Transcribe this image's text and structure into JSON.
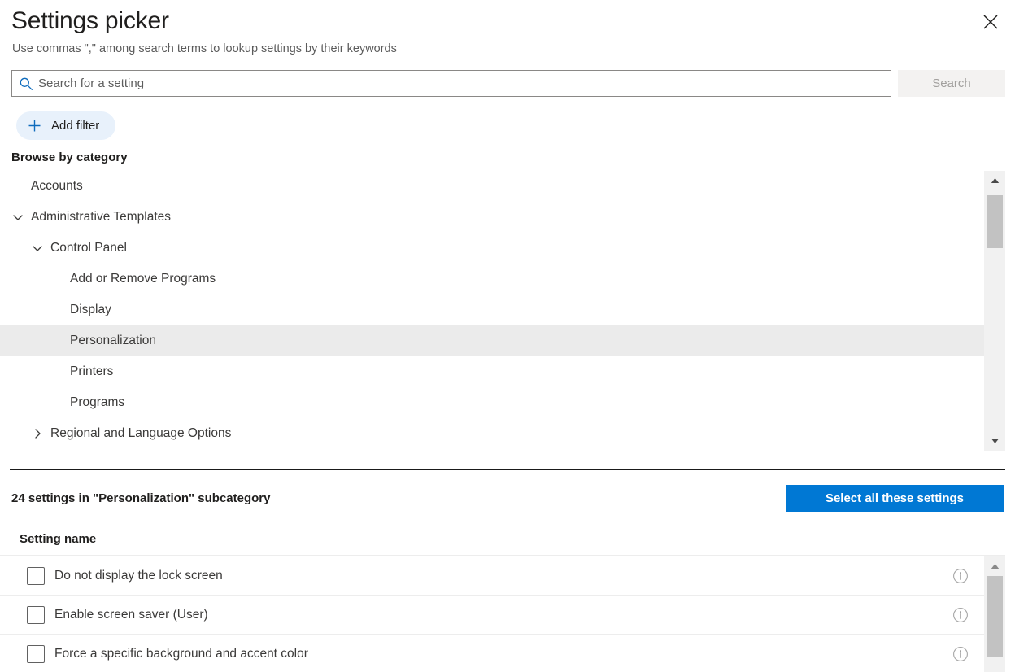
{
  "header": {
    "title": "Settings picker",
    "subtitle": "Use commas \",\" among search terms to lookup settings by their keywords",
    "close_icon": "close-icon"
  },
  "search": {
    "placeholder": "Search for a setting",
    "value": "",
    "icon": "search-icon",
    "button_label": "Search",
    "button_enabled": false
  },
  "filters": {
    "add_filter_label": "Add filter",
    "add_filter_icon": "plus-icon",
    "accent_color": "#0078d4",
    "pill_background": "#e8f1fb"
  },
  "browse": {
    "heading": "Browse by category",
    "tree": [
      {
        "label": "Accounts",
        "depth": 0,
        "state": "leaf",
        "selected": false
      },
      {
        "label": "Administrative Templates",
        "depth": 0,
        "state": "expanded",
        "selected": false
      },
      {
        "label": "Control Panel",
        "depth": 1,
        "state": "expanded",
        "selected": false
      },
      {
        "label": "Add or Remove Programs",
        "depth": 2,
        "state": "leaf",
        "selected": false
      },
      {
        "label": "Display",
        "depth": 2,
        "state": "leaf",
        "selected": false
      },
      {
        "label": "Personalization",
        "depth": 2,
        "state": "leaf",
        "selected": true
      },
      {
        "label": "Printers",
        "depth": 2,
        "state": "leaf",
        "selected": false
      },
      {
        "label": "Programs",
        "depth": 2,
        "state": "leaf",
        "selected": false
      },
      {
        "label": "Regional and Language Options",
        "depth": 1,
        "state": "collapsed",
        "selected": false
      }
    ],
    "scrollbar": {
      "up_icon": "scroll-up-arrow-icon",
      "down_icon": "scroll-down-arrow-icon",
      "thumb_top_pct": 2,
      "thumb_height_pct": 22,
      "thumb_color": "#c2c2c2",
      "track_color": "#f1f1f1"
    }
  },
  "results": {
    "count_text": "24 settings in \"Personalization\" subcategory",
    "select_all_label": "Select all these settings",
    "select_all_color": "#0078d4",
    "column_header": "Setting name",
    "rows": [
      {
        "label": "Do not display the lock screen",
        "checked": false,
        "info_icon": "info-icon"
      },
      {
        "label": "Enable screen saver (User)",
        "checked": false,
        "info_icon": "info-icon"
      },
      {
        "label": "Force a specific background and accent color",
        "checked": false,
        "info_icon": "info-icon"
      }
    ],
    "scrollbar": {
      "up_icon": "scroll-up-arrow-icon",
      "thumb_top_pct": 0,
      "thumb_height_pct": 85,
      "thumb_color": "#c2c2c2",
      "track_color": "#f1f1f1"
    }
  }
}
